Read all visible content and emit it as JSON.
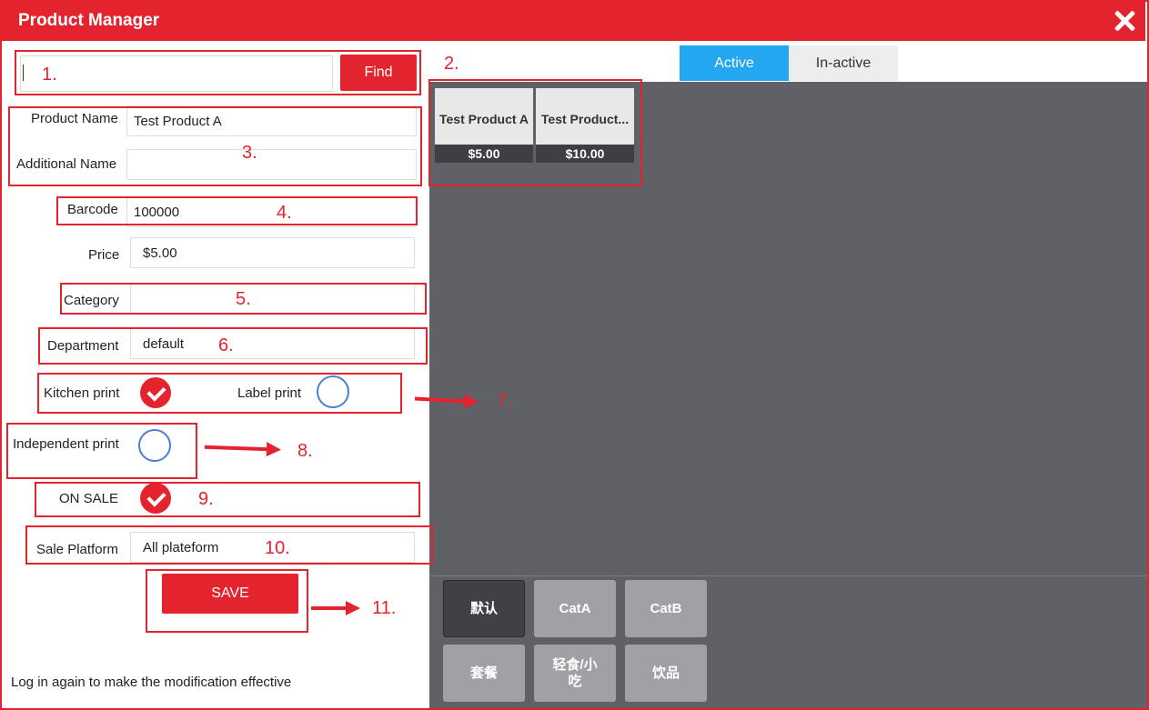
{
  "window": {
    "title": "Product Manager"
  },
  "search": {
    "value": "",
    "find_label": "Find"
  },
  "tabs": [
    {
      "label": "Active"
    },
    {
      "label": "In-active"
    }
  ],
  "form": {
    "product_name": {
      "label": "Product Name",
      "value": "Test Product A"
    },
    "additional_name": {
      "label": "Additional Name",
      "value": ""
    },
    "barcode": {
      "label": "Barcode",
      "value": "100000"
    },
    "price": {
      "label": "Price",
      "value": "$5.00"
    },
    "category": {
      "label": "Category",
      "value": ""
    },
    "department": {
      "label": "Department",
      "value": "default"
    },
    "kitchen_print": {
      "label": "Kitchen print",
      "checked": true
    },
    "label_print": {
      "label": "Label print",
      "checked": false
    },
    "independent_print": {
      "label": "Independent print",
      "checked": false
    },
    "on_sale": {
      "label": "ON SALE",
      "checked": true
    },
    "sale_platform": {
      "label": "Sale Platform",
      "value": "All plateform"
    },
    "save_label": "SAVE"
  },
  "footer_note": "Log in again to make the modification effective",
  "products": [
    {
      "name": "Test Product A",
      "price": "$5.00"
    },
    {
      "name": "Test Product...",
      "price": "$10.00"
    }
  ],
  "categories": [
    {
      "label": "默认",
      "selected": true
    },
    {
      "label": "CatA",
      "selected": false
    },
    {
      "label": "CatB",
      "selected": false
    },
    {
      "label": "套餐",
      "selected": false
    },
    {
      "label": "轻食/小吃",
      "selected": false
    },
    {
      "label": "饮品",
      "selected": false
    }
  ],
  "annotations": [
    "1.",
    "2.",
    "3.",
    "4.",
    "5.",
    "6.",
    "7.",
    "8.",
    "9.",
    "10.",
    "11."
  ],
  "colors": {
    "brand_red": "#e3242f",
    "active_tab": "#22a7f0",
    "pane_gray": "#5f6166"
  }
}
